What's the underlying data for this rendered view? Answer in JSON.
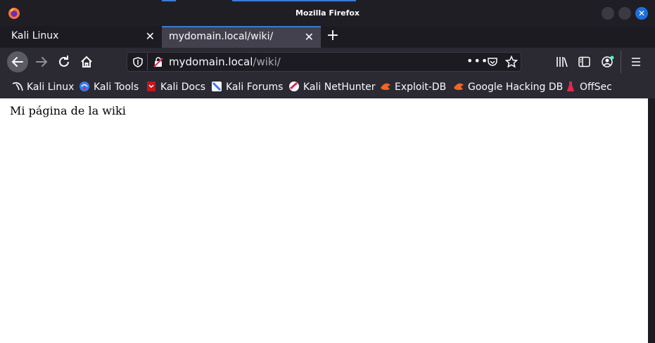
{
  "window": {
    "title": "Mozilla Firefox"
  },
  "tabs": [
    {
      "label": "Kali Linux",
      "active": false
    },
    {
      "label": "mydomain.local/wiki/",
      "active": true
    }
  ],
  "urlbar": {
    "host": "mydomain.local",
    "path": "/wiki/"
  },
  "bookmarks": [
    {
      "label": "Kali Linux",
      "icon": "kali-dragon-icon"
    },
    {
      "label": "Kali Tools",
      "icon": "kali-tools-icon"
    },
    {
      "label": "Kali Docs",
      "icon": "kali-docs-icon"
    },
    {
      "label": "Kali Forums",
      "icon": "kali-forums-icon"
    },
    {
      "label": "Kali NetHunter",
      "icon": "nethunter-icon"
    },
    {
      "label": "Exploit-DB",
      "icon": "exploit-db-icon"
    },
    {
      "label": "Google Hacking DB",
      "icon": "ghdb-icon"
    },
    {
      "label": "OffSec",
      "icon": "offsec-icon"
    }
  ],
  "page": {
    "body_text": "Mi página de la wiki"
  },
  "colors": {
    "accent": "#3a7bd5",
    "chrome": "#2b2a33",
    "titlebar": "#1f1e25"
  }
}
